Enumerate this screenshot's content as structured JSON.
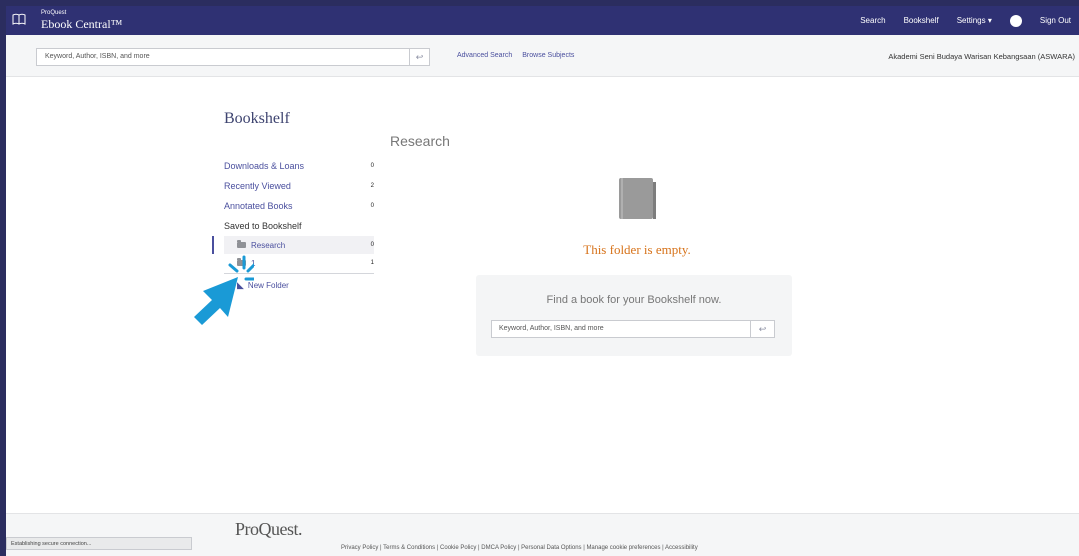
{
  "header": {
    "brand_small": "ProQuest",
    "brand_name": "Ebook Central™",
    "nav": {
      "search": "Search",
      "bookshelf": "Bookshelf",
      "settings": "Settings ▾",
      "help": "?",
      "signout": "Sign Out"
    }
  },
  "searchbar": {
    "placeholder": "Keyword, Author, ISBN, and more",
    "submit_icon": "enter-icon",
    "advanced": "Advanced Search",
    "browse": "Browse Subjects",
    "institution": "Akademi Seni Budaya Warisan Kebangsaan (ASWARA)"
  },
  "bookshelf": {
    "title": "Bookshelf",
    "items": [
      {
        "label": "Downloads & Loans",
        "count": "0"
      },
      {
        "label": "Recently Viewed",
        "count": "2"
      },
      {
        "label": "Annotated Books",
        "count": "0"
      }
    ],
    "saved_heading": "Saved to Bookshelf",
    "folders": [
      {
        "label": "Research",
        "count": "0"
      },
      {
        "label": "1",
        "count": "1"
      }
    ],
    "new_folder": "New Folder"
  },
  "main": {
    "folder_title": "Research",
    "empty_message": "This folder is empty.",
    "find_title": "Find a book for your Bookshelf now.",
    "find_placeholder": "Keyword, Author, ISBN, and more"
  },
  "footer": {
    "logo": "ProQuest.",
    "links": "Privacy Policy | Terms & Conditions | Cookie Policy | DMCA Policy | Personal Data Options | Manage cookie preferences | Accessibility"
  },
  "status": {
    "text": "Establishing secure connection..."
  },
  "colors": {
    "header_bg": "#2f3173",
    "link": "#4a4f9e",
    "empty_orange": "#d7731b",
    "pointer": "#1a9ad6"
  }
}
